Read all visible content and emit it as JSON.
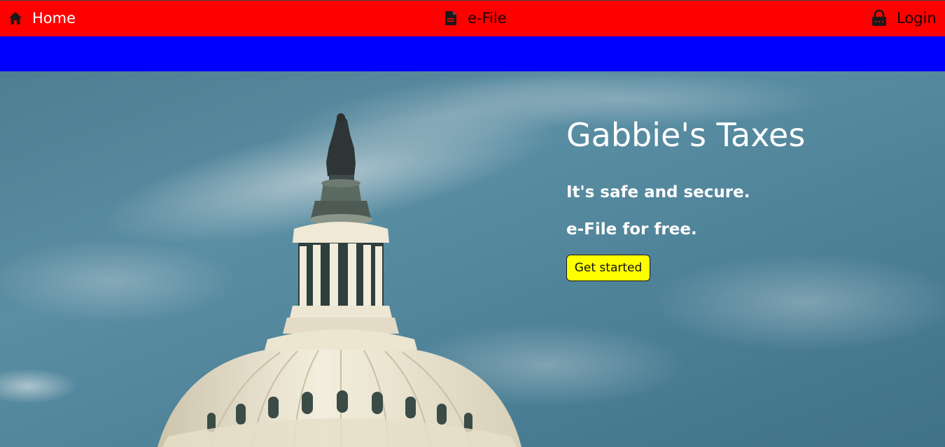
{
  "nav": {
    "home_label": "Home",
    "efile_label": "e-File",
    "login_label": "Login",
    "colors": {
      "bar": "#ff0000",
      "band": "#0000ff"
    }
  },
  "hero": {
    "title": "Gabbie's Taxes",
    "line1": "It's safe and secure.",
    "line2": "e-File for free.",
    "cta_label": "Get started",
    "cta_color": "#ffff00",
    "background_image": "capitol-dome-photo"
  }
}
